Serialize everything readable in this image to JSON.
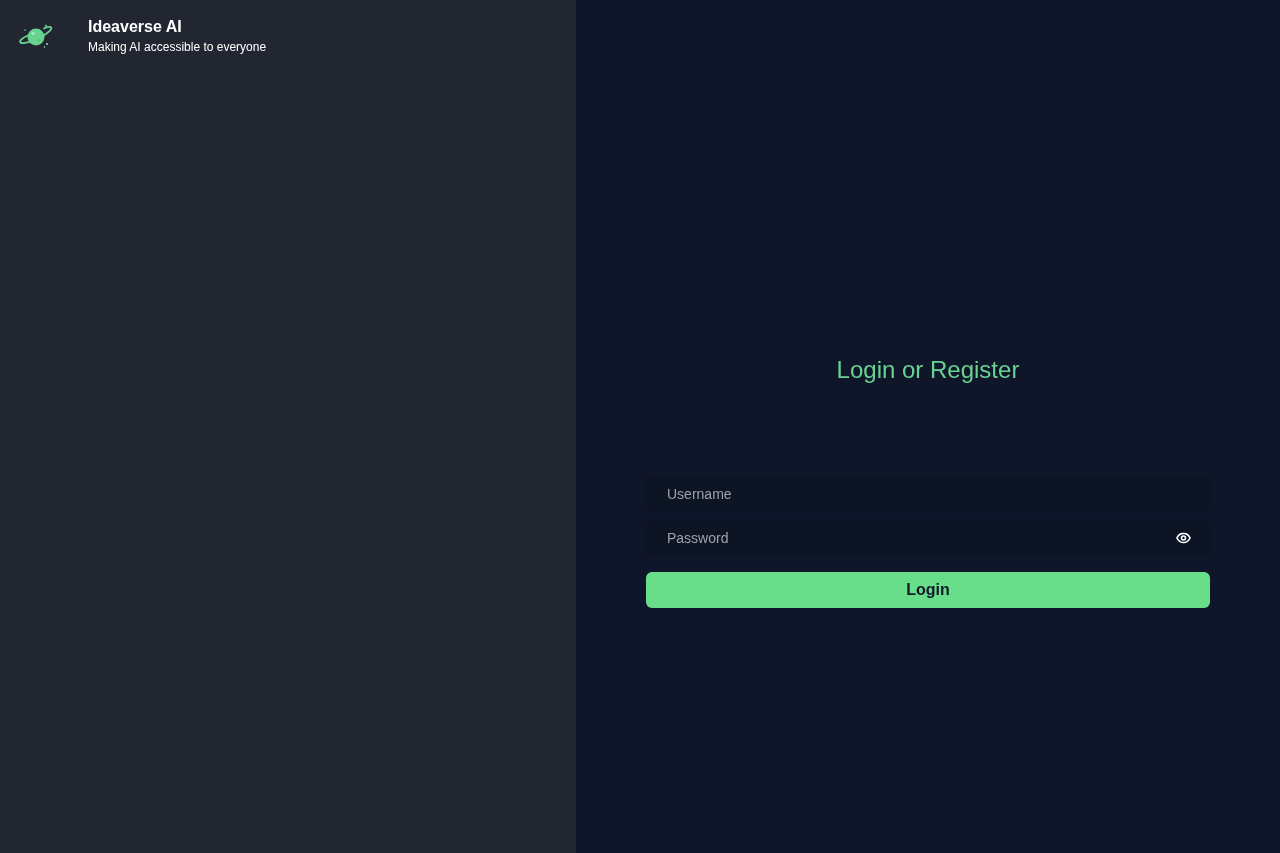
{
  "sidebar": {
    "brand": {
      "title": "Ideaverse AI",
      "tagline": "Making AI accessible to everyone"
    }
  },
  "login": {
    "heading": "Login or Register",
    "fields": [
      {
        "kind": "text",
        "placeholder": "Username"
      },
      {
        "kind": "password",
        "placeholder": "Password"
      }
    ],
    "submit": "Login"
  }
}
